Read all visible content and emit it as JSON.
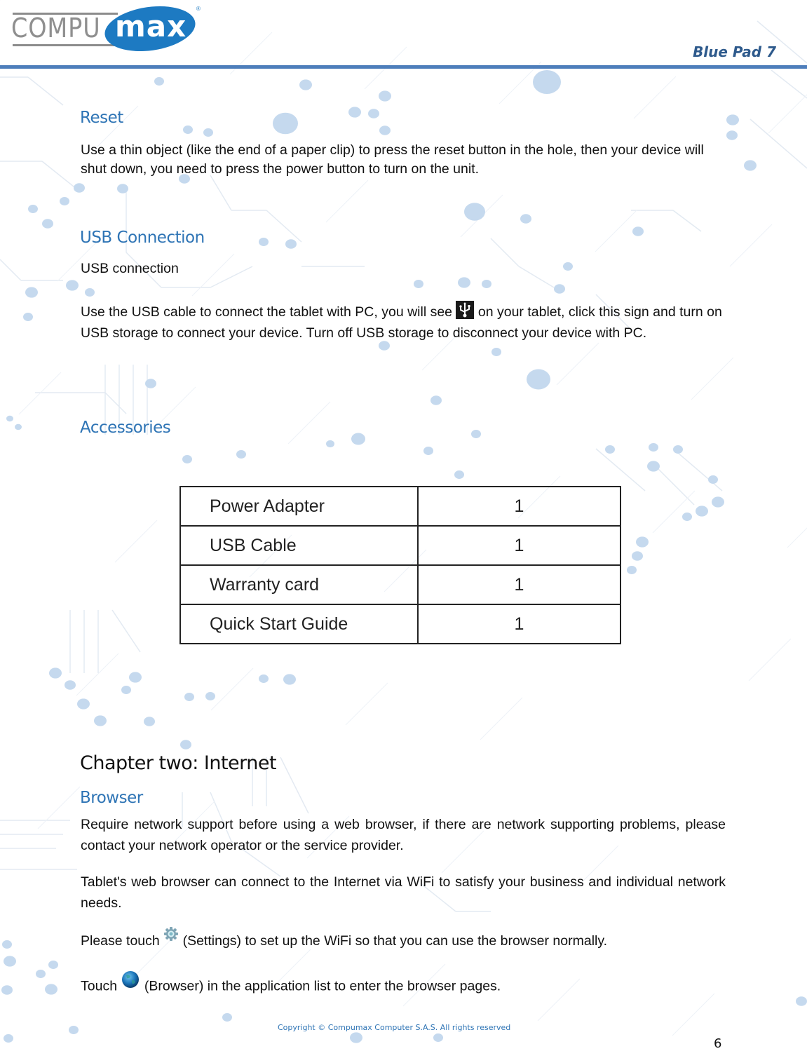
{
  "header": {
    "logo": {
      "left_text": "COMPU",
      "right_text": "max",
      "registered": "®",
      "brand_color": "#1d7ac2"
    },
    "document_title": "Blue Pad 7",
    "rule_color": "#4d7ebb"
  },
  "sections": {
    "reset": {
      "heading": "Reset",
      "body": "Use a thin object (like the end of a paper clip) to press the reset button in the hole, then your device will shut down, you need to press the power button to turn on the unit."
    },
    "usb": {
      "heading": "USB Connection",
      "subheading": "USB connection",
      "body_before_icon": "Use the USB cable to connect the tablet with PC, you will see ",
      "icon": "usb-icon",
      "body_after_icon": " on your tablet, click this sign and turn on USB storage to connect your device. Turn off USB storage to disconnect your device with PC."
    },
    "accessories": {
      "heading": "Accessories",
      "items": [
        {
          "name": "Power Adapter",
          "qty": "1"
        },
        {
          "name": "USB Cable",
          "qty": "1"
        },
        {
          "name": "Warranty card",
          "qty": "1"
        },
        {
          "name": "Quick Start Guide",
          "qty": "1"
        }
      ]
    },
    "chapter_two": {
      "heading": "Chapter two: Internet",
      "browser": {
        "heading": "Browser",
        "para1": "Require network support before using a web browser, if there are network supporting problems, please contact your network operator or the service provider.",
        "para2": "Tablet's web browser can connect to the Internet via WiFi to satisfy your business and individual network needs.",
        "para3_before": "Please touch ",
        "para3_icon": "settings-gear-icon",
        "para3_after": " (Settings) to set up the WiFi so that you can use the browser normally.",
        "para4_before": "Touch ",
        "para4_icon": "browser-globe-icon",
        "para4_after": " (Browser) in the application list to enter the browser pages."
      }
    }
  },
  "footer": {
    "copyright": "Copyright © Compumax Computer S.A.S. All rights reserved",
    "page_number": "6"
  },
  "colors": {
    "heading_blue": "#2e74b5",
    "title_blue": "#2e5a8c",
    "dot_blue": "#c5d9ee"
  }
}
